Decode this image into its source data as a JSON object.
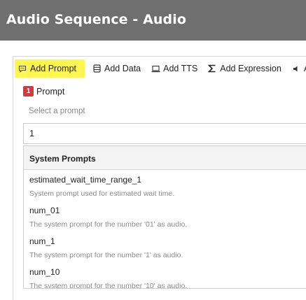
{
  "window": {
    "title": "Audio Sequence - Audio"
  },
  "toolbar": {
    "items": [
      {
        "label": "Add Prompt",
        "icon": "speech-bubble-icon"
      },
      {
        "label": "Add Data",
        "icon": "database-icon"
      },
      {
        "label": "Add TTS",
        "icon": "laptop-icon"
      },
      {
        "label": "Add Expression",
        "icon": "sigma-icon"
      },
      {
        "label": "A",
        "icon": "speaker-icon"
      }
    ],
    "highlight_color": "#fff64f"
  },
  "prompt_section": {
    "badge": "1",
    "badge_color": "#d9363e",
    "label": "Prompt",
    "select_hint": "Select a prompt",
    "search_value": "1"
  },
  "list": {
    "header": "System Prompts",
    "items": [
      {
        "name": "estimated_wait_time_range_1",
        "description": "System prompt used for estimated wait time."
      },
      {
        "name": "num_01",
        "description": "The system prompt for the number '01' as audio."
      },
      {
        "name": "num_1",
        "description": "The system prompt for the number '1' as audio."
      },
      {
        "name": "num_10",
        "description": "The system prompt for the number '10' as audio."
      }
    ]
  }
}
